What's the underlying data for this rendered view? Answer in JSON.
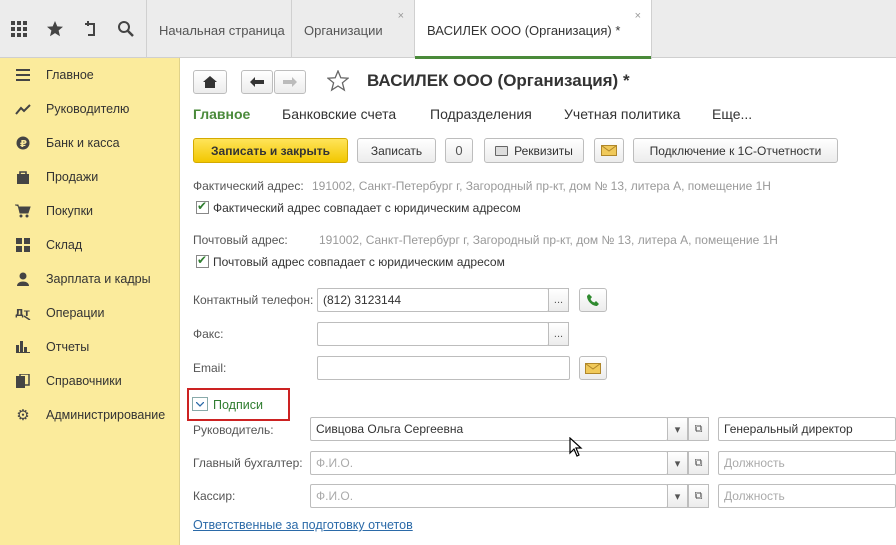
{
  "topbar": {
    "icons": [
      "apps-grid-icon",
      "star-icon",
      "history-icon",
      "search-icon"
    ],
    "tabs": [
      {
        "label": "Начальная страница",
        "close": ""
      },
      {
        "label": "Организации",
        "close": "×"
      },
      {
        "label": "ВАСИЛЕК ООО (Организация) *",
        "close": "×"
      }
    ]
  },
  "sidebar": {
    "items": [
      {
        "label": "Главное",
        "icon": "menu-lines-icon"
      },
      {
        "label": "Руководителю",
        "icon": "trend-chart-icon"
      },
      {
        "label": "Банк и касса",
        "icon": "ruble-coin-icon"
      },
      {
        "label": "Продажи",
        "icon": "shopping-bag-icon"
      },
      {
        "label": "Покупки",
        "icon": "cart-icon"
      },
      {
        "label": "Склад",
        "icon": "warehouse-grid-icon"
      },
      {
        "label": "Зарплата и кадры",
        "icon": "person-icon"
      },
      {
        "label": "Операции",
        "icon": "operations-icon"
      },
      {
        "label": "Отчеты",
        "icon": "bar-chart-icon"
      },
      {
        "label": "Справочники",
        "icon": "books-icon"
      },
      {
        "label": "Администрирование",
        "icon": "gear-icon"
      }
    ]
  },
  "form": {
    "title": "ВАСИЛЕК ООО (Организация) *",
    "subnav": [
      "Главное",
      "Банковские счета",
      "Подразделения",
      "Учетная политика",
      "Еще..."
    ],
    "buttons": {
      "save_close": "Записать и закрыть",
      "save": "Записать",
      "requisites": "Реквизиты",
      "connect": "Подключение к 1С-Отчетности"
    },
    "actual_address": {
      "label": "Фактический адрес:",
      "value": "191002, Санкт-Петербург г, Загородный пр-кт, дом № 13, литера А, помещение 1Н",
      "checkbox": "Фактический адрес совпадает с юридическим адресом"
    },
    "postal_address": {
      "label": "Почтовый адрес:",
      "value": "191002, Санкт-Петербург г, Загородный пр-кт, дом № 13, литера А, помещение 1Н",
      "checkbox": "Почтовый адрес совпадает с юридическим адресом"
    },
    "phone": {
      "label": "Контактный телефон:",
      "value": "(812) 3123144"
    },
    "fax": {
      "label": "Факс:",
      "value": ""
    },
    "email": {
      "label": "Email:",
      "value": ""
    },
    "signatures": {
      "toggle": "Подписи",
      "rows": [
        {
          "label": "Руководитель:",
          "name": "Сивцова Ольга Сергеевна",
          "position": "Генеральный директор"
        },
        {
          "label": "Главный бухгалтер:",
          "name_placeholder": "Ф.И.О.",
          "position_placeholder": "Должность"
        },
        {
          "label": "Кассир:",
          "name_placeholder": "Ф.И.О.",
          "position_placeholder": "Должность"
        }
      ]
    },
    "responsible_link": "Ответственные за подготовку отчетов"
  }
}
